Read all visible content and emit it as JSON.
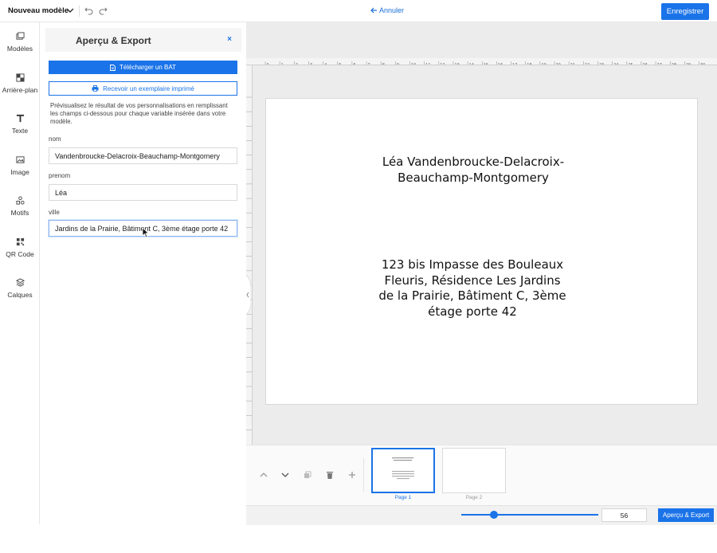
{
  "topbar": {
    "model_name": "Nouveau modèle",
    "cancel_label": "Annuler",
    "save_label": "Enregistrer"
  },
  "sidebar": {
    "items": [
      {
        "label": "Modèles",
        "icon": "templates-icon"
      },
      {
        "label": "Arrière-plan",
        "icon": "background-icon"
      },
      {
        "label": "Texte",
        "icon": "text-icon"
      },
      {
        "label": "Image",
        "icon": "image-icon"
      },
      {
        "label": "Motifs",
        "icon": "shapes-icon"
      },
      {
        "label": "QR Code",
        "icon": "qrcode-icon"
      },
      {
        "label": "Calques",
        "icon": "layers-icon"
      }
    ]
  },
  "panel": {
    "title": "Aperçu & Export",
    "close_label": "×",
    "bat_label": "Télécharger un BAT",
    "print_label": "Recevoir un exemplaire imprimé",
    "description": "Prévisualisez le résultat de vos personnalisations en remplissant les champs ci-dessous pour chaque variable insérée dans votre modèle.",
    "fields": [
      {
        "label": "nom",
        "value": "Vandenbroucke-Delacroix-Beauchamp-Montgomery"
      },
      {
        "label": "prenom",
        "value": "Léa"
      },
      {
        "label": "ville",
        "value": "Jardins de la Prairie, Bâtiment C, 3ème étage porte 42"
      }
    ]
  },
  "canvas": {
    "name_text": "Léa Vandenbroucke-Delacroix-Beauchamp-Montgomery",
    "address_text": "123 bis Impasse des Bouleaux Fleuris, Résidence Les Jardins de la Prairie, Bâtiment C, 3ème étage porte 42",
    "ruler_ticks": [
      "0",
      "1",
      "2",
      "3",
      "4",
      "5",
      "6",
      "7",
      "8",
      "9",
      "10",
      "11",
      "12",
      "13",
      "14",
      "15",
      "16",
      "17",
      "18",
      "19",
      "20",
      "21",
      "22",
      "23",
      "24",
      "25",
      "26",
      "27",
      "28",
      "29",
      "30"
    ]
  },
  "pages": [
    {
      "label": "Page 1",
      "active": true
    },
    {
      "label": "Page 2",
      "active": false
    }
  ],
  "zoom": {
    "value": "56",
    "slider_fraction": 0.24
  },
  "bottom": {
    "export_label": "Aperçu & Export"
  },
  "colors": {
    "accent": "#1a73e8",
    "workspace": "#ececec"
  }
}
